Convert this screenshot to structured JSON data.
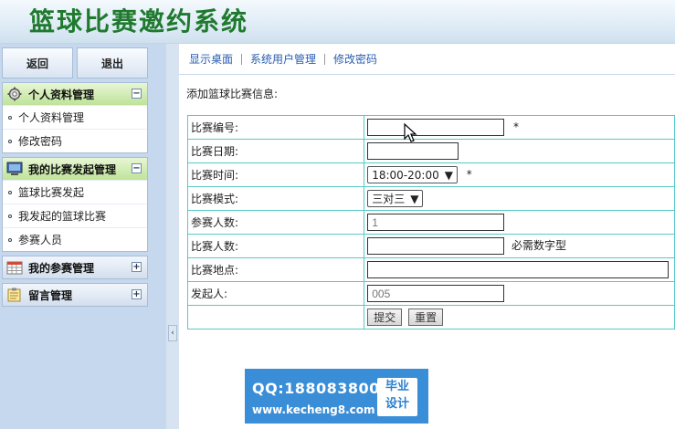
{
  "app": {
    "title": "篮球比赛邀约系统"
  },
  "sidebar": {
    "top_buttons": [
      {
        "label": "返回"
      },
      {
        "label": "退出"
      }
    ],
    "panels": [
      {
        "title": "个人资料管理",
        "icon": "gear-icon",
        "toggle": "−",
        "items": [
          {
            "label": "个人资料管理"
          },
          {
            "label": "修改密码"
          }
        ]
      },
      {
        "title": "我的比赛发起管理",
        "icon": "monitor-icon",
        "toggle": "−",
        "items": [
          {
            "label": "篮球比赛发起"
          },
          {
            "label": "我发起的篮球比赛"
          },
          {
            "label": "参赛人员"
          }
        ]
      },
      {
        "title": "我的参赛管理",
        "icon": "calendar-icon",
        "toggle": "+"
      },
      {
        "title": "留言管理",
        "icon": "notepad-icon",
        "toggle": "+"
      }
    ],
    "collapse_glyph": "‹"
  },
  "topnav": {
    "items": [
      {
        "label": "显示桌面"
      },
      {
        "label": "系统用户管理"
      },
      {
        "label": "修改密码"
      }
    ]
  },
  "main": {
    "section_title": "添加篮球比赛信息:",
    "form": {
      "match_no": {
        "label": "比赛编号:",
        "value": "",
        "required": "*"
      },
      "match_date": {
        "label": "比赛日期:",
        "value": ""
      },
      "match_time": {
        "label": "比赛时间:",
        "selected": "18:00-20:00",
        "required": "*"
      },
      "match_mode": {
        "label": "比赛模式:",
        "selected": "三对三"
      },
      "player_count": {
        "label": "参赛人数:",
        "value": "1"
      },
      "match_count": {
        "label": "比赛人数:",
        "value": "",
        "hint": "必需数字型"
      },
      "location": {
        "label": "比赛地点:",
        "value": ""
      },
      "initiator": {
        "label": "发起人:",
        "value": "005"
      },
      "submit_label": "提交",
      "reset_label": "重置"
    }
  },
  "watermark": {
    "qq": "QQ:188083800",
    "url": "www.kecheng8.com",
    "badge_line1": "毕业",
    "badge_line2": "设计"
  },
  "colors": {
    "title_green": "#1f7a2e",
    "table_border": "#5ac8c8",
    "link_blue": "#2a5db0",
    "watermark_blue": "#3a8ed8"
  }
}
